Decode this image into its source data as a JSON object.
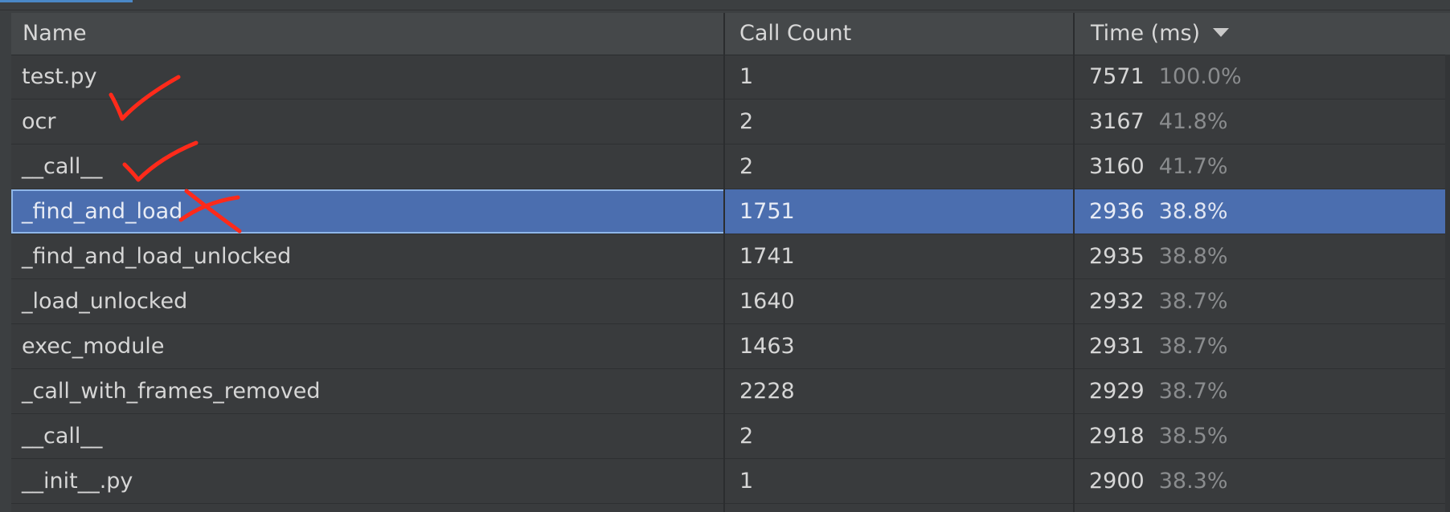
{
  "table": {
    "columns": [
      {
        "label": "Name"
      },
      {
        "label": "Call Count"
      },
      {
        "label": "Time (ms)",
        "sorted": "descending"
      }
    ],
    "rows": [
      {
        "name": "test.py",
        "count": "1",
        "time": "7571",
        "pct": "100.0%"
      },
      {
        "name": "ocr",
        "count": "2",
        "time": "3167",
        "pct": "41.8%"
      },
      {
        "name": "__call__",
        "count": "2",
        "time": "3160",
        "pct": "41.7%"
      },
      {
        "name": "_find_and_load",
        "count": "1751",
        "time": "2936",
        "pct": "38.8%",
        "selected": true
      },
      {
        "name": "_find_and_load_unlocked",
        "count": "1741",
        "time": "2935",
        "pct": "38.8%"
      },
      {
        "name": "_load_unlocked",
        "count": "1640",
        "time": "2932",
        "pct": "38.7%"
      },
      {
        "name": "exec_module",
        "count": "1463",
        "time": "2931",
        "pct": "38.7%"
      },
      {
        "name": "_call_with_frames_removed",
        "count": "2228",
        "time": "2929",
        "pct": "38.7%"
      },
      {
        "name": "__call__",
        "count": "2",
        "time": "2918",
        "pct": "38.5%"
      },
      {
        "name": "__init__.py",
        "count": "1",
        "time": "2900",
        "pct": "38.3%"
      }
    ]
  },
  "colors": {
    "background": "#3c3f41",
    "header": "#45484a",
    "selection": "#4b6eaf",
    "annotation": "#ff2a1a"
  }
}
